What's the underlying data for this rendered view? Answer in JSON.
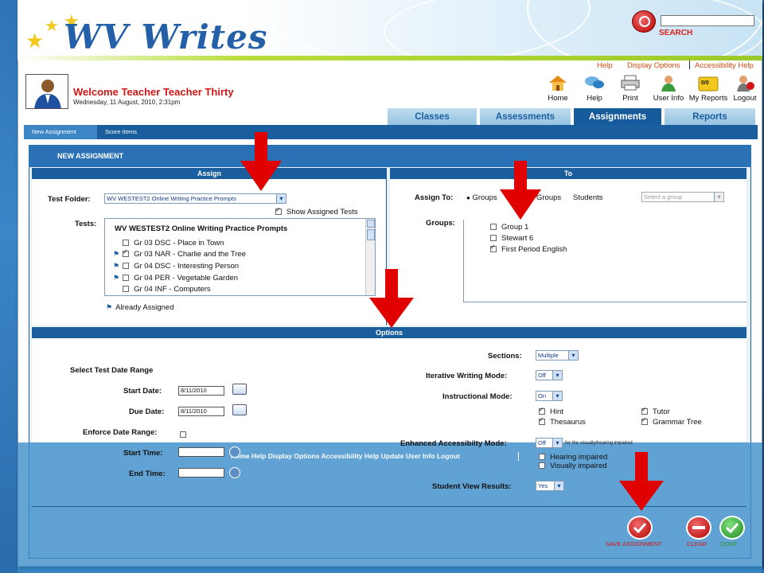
{
  "app": {
    "logo_text": "WV Writes"
  },
  "search": {
    "placeholder": "",
    "label": "SEARCH"
  },
  "top_links": [
    "Help",
    "Display Options",
    "Accessibility Help"
  ],
  "welcome": {
    "title": "Welcome Teacher Teacher Thirty",
    "date": "Wednesday, 11 August, 2010,  2:31pm"
  },
  "toolbar": [
    {
      "label": "Home",
      "icon": "home-icon"
    },
    {
      "label": "Help",
      "icon": "help-bubbles-icon"
    },
    {
      "label": "Print",
      "icon": "printer-icon"
    },
    {
      "label": "User Info",
      "icon": "user-icon"
    },
    {
      "label": "My Reports",
      "icon": "reports-folder-icon",
      "badge": "0/0"
    },
    {
      "label": "Logout",
      "icon": "logout-icon"
    }
  ],
  "tabs": [
    {
      "label": "Classes"
    },
    {
      "label": "Assessments"
    },
    {
      "label": "Assignments",
      "active": true
    },
    {
      "label": "Reports"
    }
  ],
  "subnav": [
    {
      "label": "New Assignment",
      "active": true
    },
    {
      "label": "Score Items"
    }
  ],
  "panel": {
    "title": "NEW ASSIGNMENT"
  },
  "assign": {
    "header": "Assign",
    "test_folder_label": "Test Folder:",
    "test_folder_value": "WV WESTEST2 Online Writing Practice Prompts",
    "show_assigned_label": "Show Assigned Tests",
    "tests_label": "Tests:",
    "tests_heading": "WV WESTEST2 Online Writing Practice Prompts",
    "tests": [
      {
        "label": "Gr 03 DSC - Place in Town",
        "flag": false,
        "checked": false
      },
      {
        "label": "Gr 03 NAR - Charlie and the Tree",
        "flag": true,
        "checked": true
      },
      {
        "label": "Gr 04 DSC - Interesting Person",
        "flag": true,
        "checked": false
      },
      {
        "label": "Gr 04 PER - Vegetable Garden",
        "flag": true,
        "checked": false
      },
      {
        "label": "Gr 04 INF - Computers",
        "flag": false,
        "checked": false
      }
    ],
    "already_assigned_label": "Already Assigned"
  },
  "to": {
    "header": "To",
    "assign_to_label": "Assign To:",
    "options": [
      "Groups",
      "Groups",
      "Students"
    ],
    "group_select_placeholder": "Select a group",
    "groups_label": "Groups:",
    "groups": [
      {
        "label": "Group 1",
        "checked": false
      },
      {
        "label": "Stewart 6",
        "checked": false
      },
      {
        "label": "First Period English",
        "checked": true
      }
    ]
  },
  "options": {
    "header": "Options",
    "select_range_label": "Select Test Date Range",
    "start_date_label": "Start Date:",
    "start_date": "8/11/2010",
    "due_date_label": "Due Date:",
    "due_date": "8/11/2010",
    "enforce_label": "Enforce Date Range:",
    "start_time_label": "Start Time:",
    "end_time_label": "End Time:",
    "sections_label": "Sections:",
    "sections_value": "Multiple",
    "iterative_label": "Iterative Writing Mode:",
    "iterative_value": "Off",
    "instructional_label": "Instructional Mode:",
    "instructional_value": "On",
    "tools": [
      {
        "label": "Hint",
        "checked": true
      },
      {
        "label": "Tutor",
        "checked": true
      },
      {
        "label": "Thesaurus",
        "checked": true
      },
      {
        "label": "Grammar Tree",
        "checked": true
      }
    ],
    "enhanced_label": "Enhanced Accessibilty Mode:",
    "enhanced_value": "Off",
    "enhanced_note": "for the visually/hearing impaired",
    "impaired": [
      {
        "label": "Hearing impaired",
        "checked": false
      },
      {
        "label": "Visually impaired",
        "checked": false
      }
    ],
    "student_view_label": "Student View Results:",
    "student_view_value": "Yes"
  },
  "overlay_links": "Home Help Display Options Accessibility Help Update User Info Logout",
  "actions": [
    {
      "label": "SAVE ASSIGNMENT",
      "color": "#d21616"
    },
    {
      "label": "CLEAR",
      "color": "#d21616"
    },
    {
      "label": "DONE",
      "color": "#2f9a2f"
    }
  ],
  "colors": {
    "brand_blue": "#1b5e9e",
    "accent_red": "#d21616",
    "arrow_red": "#e00000"
  }
}
